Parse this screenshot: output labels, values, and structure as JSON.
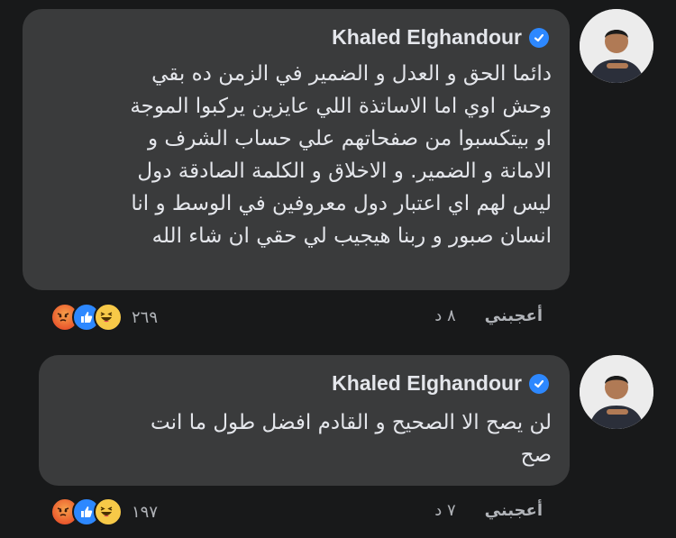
{
  "comments": [
    {
      "author": "Khaled Elghandour",
      "verified": true,
      "text": "دائما الحق و العدل و الضمير في الزمن ده بقي\nوحش اوي اما الاساتذة اللي عايزين يركبوا الموجة\nاو بيتكسبوا من صفحاتهم علي حساب الشرف و\nالامانة و الضمير. و الاخلاق و الكلمة الصادقة دول\nليس لهم اي اعتبار دول معروفين في الوسط و انا\nانسان صبور و ربنا هيجيب لي حقي ان شاء الله",
      "time": "٨ د",
      "like_label": "أعجبني",
      "reaction_count": "٢٦٩",
      "reactions": [
        "haha",
        "like",
        "angry"
      ]
    },
    {
      "author": "Khaled Elghandour",
      "verified": true,
      "text": "لن يصح الا الصحيح و القادم افضل طول ما انت\nصح",
      "time": "٧ د",
      "like_label": "أعجبني",
      "reaction_count": "١٩٧",
      "reactions": [
        "haha",
        "like",
        "angry"
      ]
    }
  ],
  "colors": {
    "background": "#18191a",
    "bubble": "#3a3b3c",
    "text": "#e4e6eb",
    "meta": "#b0b3b8",
    "verified": "#2d88ff"
  }
}
